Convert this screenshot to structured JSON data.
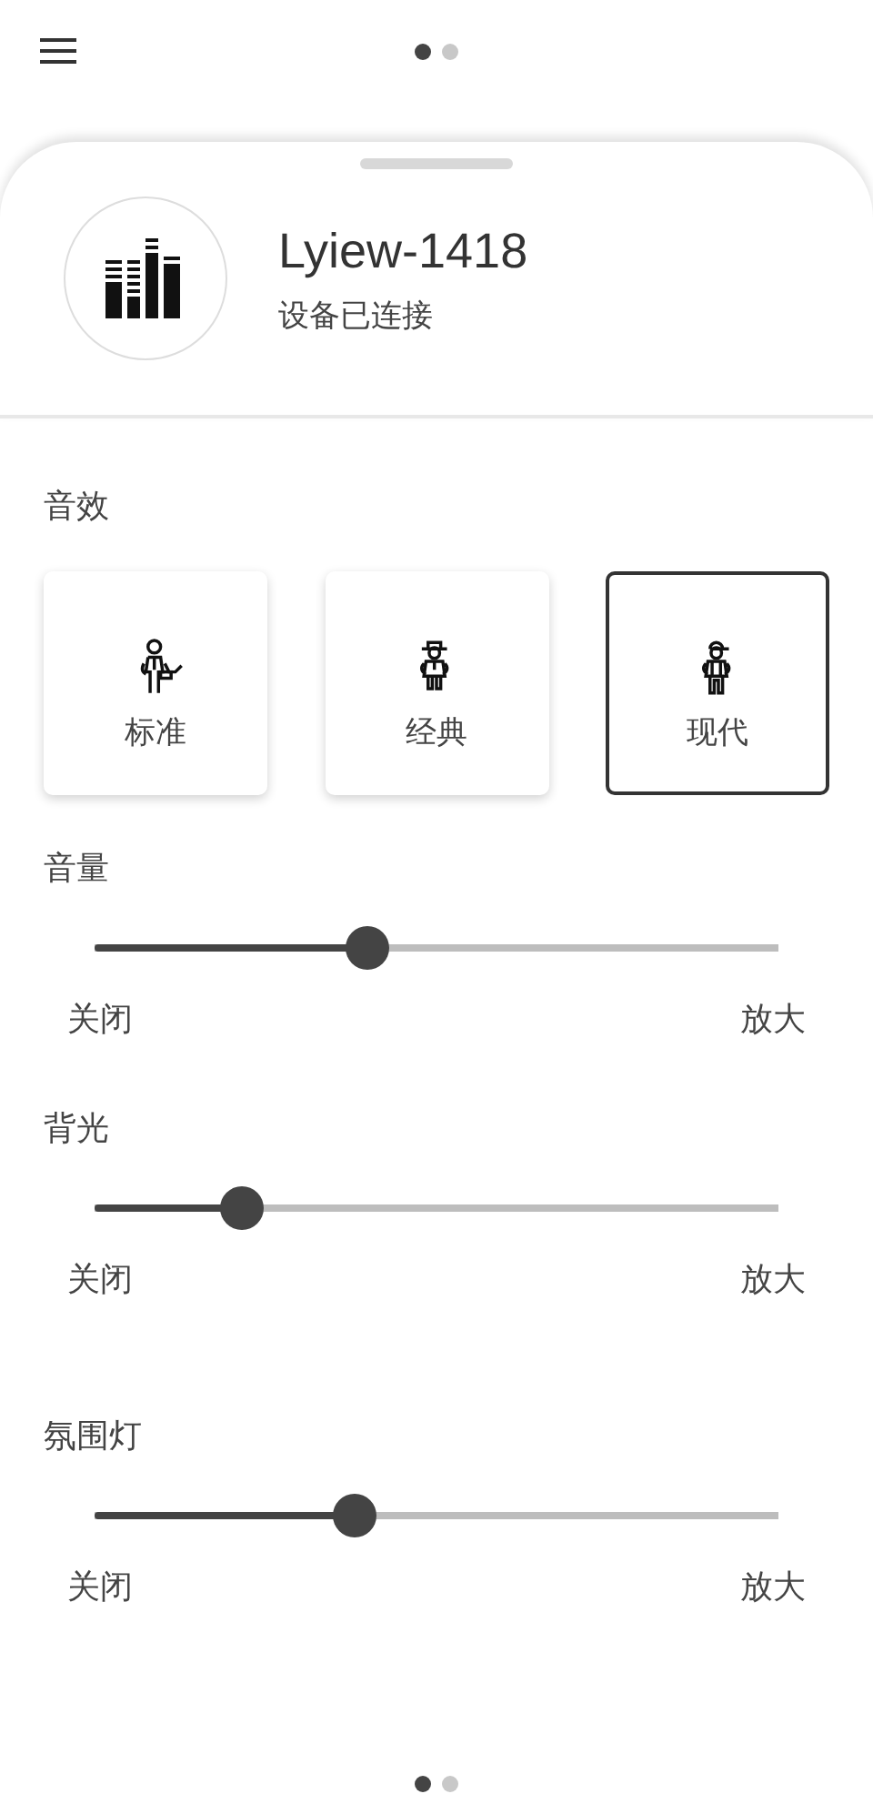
{
  "top_pager": [
    {
      "selected": true
    },
    {
      "selected": false
    }
  ],
  "device": {
    "name": "Lyiew-1418",
    "status": "设备已连接"
  },
  "effects": {
    "title": "音效",
    "modes": [
      {
        "label": "标准",
        "kind": "gardener",
        "selected": false
      },
      {
        "label": "经典",
        "kind": "cowboy",
        "selected": false
      },
      {
        "label": "现代",
        "kind": "worker",
        "selected": true
      }
    ]
  },
  "sliders": [
    {
      "title": "音量",
      "level": 0.4,
      "min_label": "关闭",
      "max_label": "放大"
    },
    {
      "title": "背光",
      "level": 0.215,
      "min_label": "关闭",
      "max_label": "放大"
    },
    {
      "title": "氛围灯",
      "level": 0.38,
      "min_label": "关闭",
      "max_label": "放大"
    }
  ],
  "bottom_pager": [
    {
      "selected": true
    },
    {
      "selected": false
    }
  ]
}
